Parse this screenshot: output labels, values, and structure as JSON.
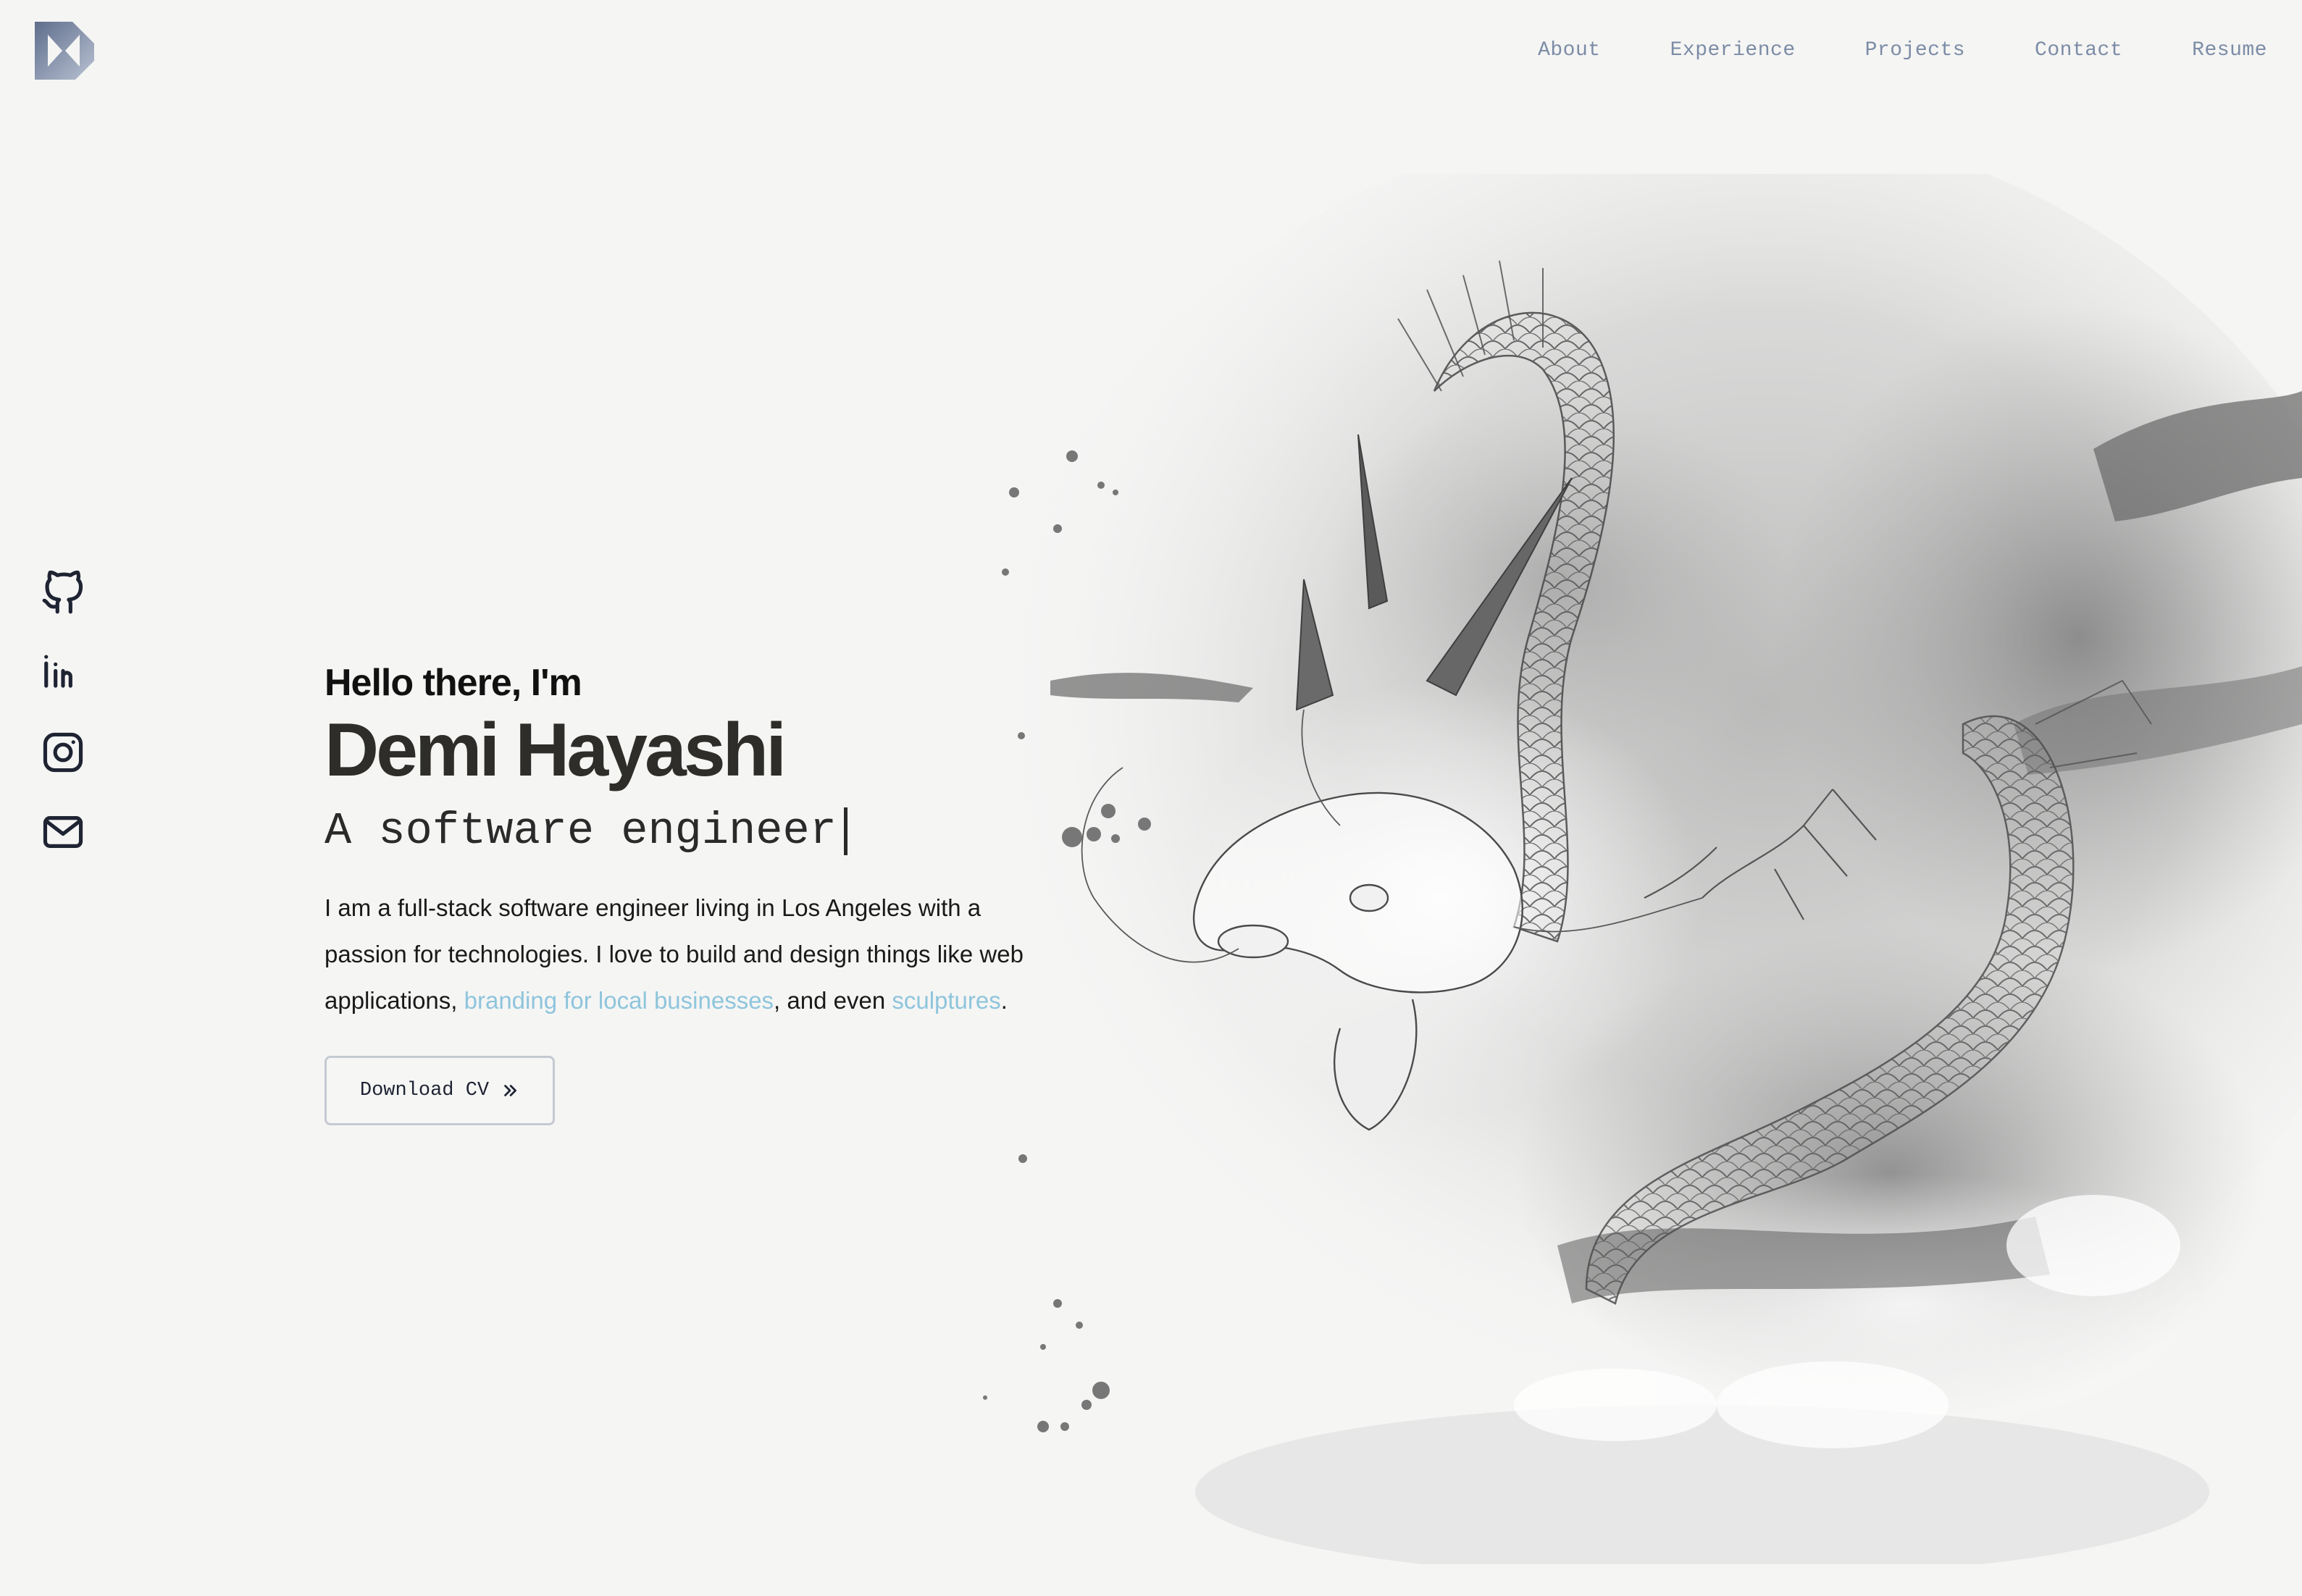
{
  "header": {
    "logo_icon": "dh-monogram-logo",
    "nav": [
      {
        "label": "About"
      },
      {
        "label": "Experience"
      },
      {
        "label": "Projects"
      },
      {
        "label": "Contact"
      },
      {
        "label": "Resume"
      }
    ]
  },
  "social": [
    {
      "icon": "github-icon"
    },
    {
      "icon": "linkedin-icon"
    },
    {
      "icon": "instagram-icon"
    },
    {
      "icon": "mail-icon"
    }
  ],
  "hero": {
    "greeting": "Hello there, I'm",
    "name": "Demi Hayashi",
    "role": "A software engineer",
    "bio_part1": "I am a full-stack software engineer living in Los Angeles with a passion for technologies. I love to build and design things like web applications, ",
    "bio_link1": "branding for local businesses",
    "bio_part2": ", and even ",
    "bio_link2": "sculptures",
    "bio_part3": ".",
    "cta_label": "Download CV",
    "cta_icon": "chevrons-right-icon"
  },
  "colors": {
    "background": "#f5f5f4",
    "nav_text": "#7c8ca6",
    "link": "#8ec5dc",
    "logo_gradient_start": "#5f6e8c",
    "logo_gradient_end": "#b9c2d3"
  },
  "illustration": {
    "icon": "ink-dragon-illustration"
  }
}
